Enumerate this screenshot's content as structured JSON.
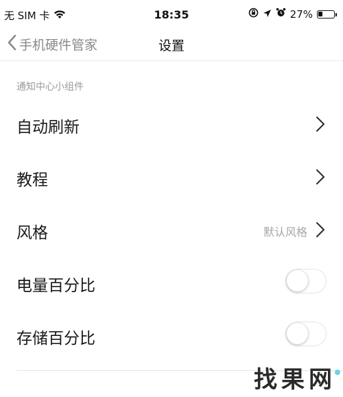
{
  "status_bar": {
    "carrier": "无 SIM 卡",
    "time": "18:35",
    "battery_percent": "27%",
    "battery_level": 0.27
  },
  "nav": {
    "back_label": "手机硬件管家",
    "title": "设置"
  },
  "section": {
    "header": "通知中心小组件",
    "rows": [
      {
        "label": "自动刷新"
      },
      {
        "label": "教程"
      },
      {
        "label": "风格",
        "value": "默认风格"
      },
      {
        "label": "电量百分比",
        "toggle_on": false
      },
      {
        "label": "存储百分比",
        "toggle_on": false
      }
    ]
  },
  "watermark": "找果网",
  "colors": {
    "background": "#ffffff",
    "secondary_text": "#8a8a8a",
    "divider": "#e9e9e9"
  }
}
